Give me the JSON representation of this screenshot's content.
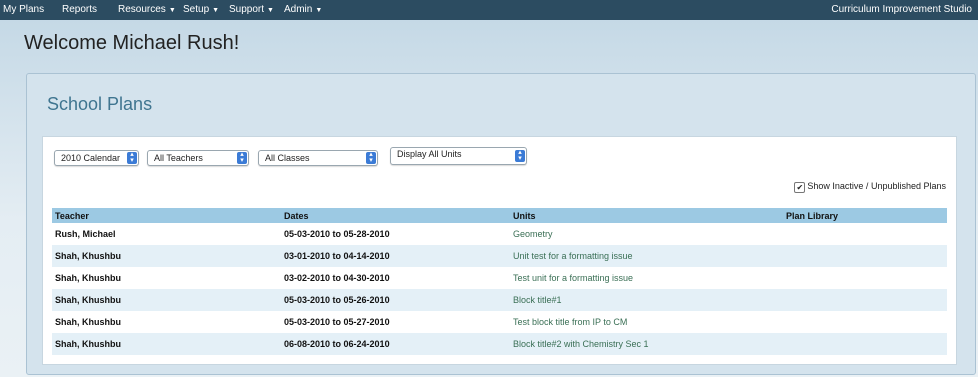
{
  "nav": {
    "items": [
      {
        "label": "My Plans",
        "has_caret": false
      },
      {
        "label": "Reports",
        "has_caret": false
      },
      {
        "label": "Resources",
        "has_caret": true
      },
      {
        "label": "Setup",
        "has_caret": true
      },
      {
        "label": "Support",
        "has_caret": true
      },
      {
        "label": "Admin",
        "has_caret": true
      }
    ],
    "brand": "Curriculum Improvement Studio",
    "caret_icon": "chevron-down-icon"
  },
  "welcome": "Welcome Michael Rush!",
  "panel": {
    "title": "School Plans"
  },
  "filters": {
    "calendar": "2010 Calendar",
    "teachers": "All Teachers",
    "classes": "All Classes",
    "units": "Display All Units"
  },
  "show_inactive": {
    "label": "Show Inactive / Unpublished Plans",
    "checked": true
  },
  "table": {
    "headers": [
      "Teacher",
      "Dates",
      "Units",
      "Plan Library"
    ],
    "rows": [
      {
        "teacher": "Rush, Michael",
        "dates": "05-03-2010 to 05-28-2010",
        "unit": "Geometry",
        "library": ""
      },
      {
        "teacher": "Shah, Khushbu",
        "dates": "03-01-2010 to 04-14-2010",
        "unit": "Unit test for a formatting issue",
        "library": ""
      },
      {
        "teacher": "Shah, Khushbu",
        "dates": "03-02-2010 to 04-30-2010",
        "unit": "Test unit for a formatting issue",
        "library": ""
      },
      {
        "teacher": "Shah, Khushbu",
        "dates": "05-03-2010 to 05-26-2010",
        "unit": "Block title#1",
        "library": ""
      },
      {
        "teacher": "Shah, Khushbu",
        "dates": "05-03-2010 to 05-27-2010",
        "unit": "Test block title from IP to CM",
        "library": ""
      },
      {
        "teacher": "Shah, Khushbu",
        "dates": "06-08-2010 to 06-24-2010",
        "unit": "Block title#2 with Chemistry Sec 1",
        "library": ""
      }
    ]
  },
  "colors": {
    "nav_bg": "#2c4c61",
    "panel_title": "#3f7590",
    "header_bg": "#9cc9e3",
    "alt_row": "#e4f0f7",
    "unit_link": "#3a6f55",
    "select_arrow": "#3b7bd6"
  }
}
